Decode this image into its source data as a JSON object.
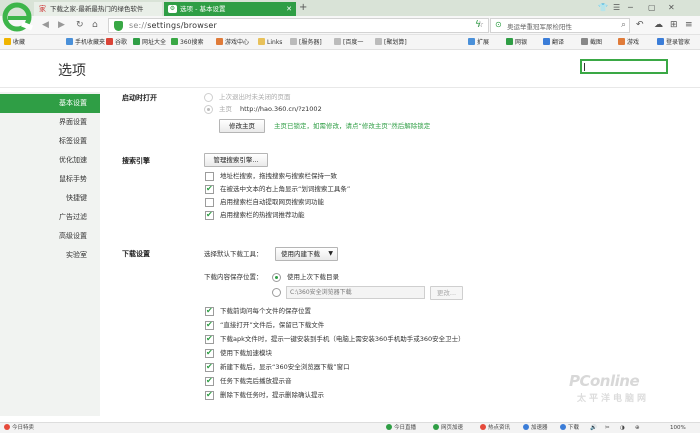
{
  "tabs": [
    {
      "label": "下载之家-最新最热门的绿色软件",
      "icon": "home-icon"
    },
    {
      "label": "选项 - 基本设置",
      "icon": "settings-page-icon",
      "active": true
    }
  ],
  "address_bar": {
    "scheme": "se://",
    "path": "settings/browser"
  },
  "search_bar": {
    "text": "奥运举重冠军尿检阳性"
  },
  "bookmarks": [
    "收藏",
    "手机收藏夹",
    "谷歌",
    "网址大全",
    "360搜索",
    "游戏中心",
    "Links",
    "[服务器]",
    "[百度一",
    "[聚划算]"
  ],
  "toolbar_right": [
    "扩展",
    "网银",
    "翻译",
    "截图",
    "游戏",
    "登录管家"
  ],
  "page": {
    "title": "选项"
  },
  "sidebar": {
    "items": [
      "基本设置",
      "界面设置",
      "标签设置",
      "优化加速",
      "鼠标手势",
      "快捷键",
      "广告过滤",
      "高级设置",
      "实验室"
    ]
  },
  "startup": {
    "title": "启动时打开",
    "option_last": "上次退出时未关闭的页面",
    "option_home": "主页",
    "home_url": "http://hao.360.cn/?z1002",
    "modify_button": "修改主页",
    "locked_note": "主页已锁定，如需修改，请点“修改主页”然后解除锁定"
  },
  "search_engine": {
    "title": "搜索引擎",
    "manage_button": "管理搜索引擎...",
    "options": [
      {
        "label": "地址栏搜索，拖拽搜索与搜索栏保持一致",
        "checked": false
      },
      {
        "label": "在被选中文本的右上角显示“划词搜索工具条”",
        "checked": true
      },
      {
        "label": "启用搜索栏自动提取网页搜索词功能",
        "checked": false
      },
      {
        "label": "启用搜索栏的热搜词推荐功能",
        "checked": true
      }
    ]
  },
  "download": {
    "title": "下载设置",
    "tool_label": "选择默认下载工具：",
    "tool_value": "使用内建下载",
    "location_label": "下载内容保存位置：",
    "option_last_dir": "使用上次下载目录",
    "path_value": "C:\\360安全浏览器下载",
    "change_button": "更改...",
    "options": [
      {
        "label": "下载前询问每个文件的保存位置",
        "checked": true
      },
      {
        "label": "“直接打开”文件后，保留已下载文件",
        "checked": true
      },
      {
        "label": "下载apk文件时，提示一键安装到手机（电脑上需安装360手机助手或360安全卫士）",
        "checked": true
      },
      {
        "label": "使用下载加速模块",
        "checked": true
      },
      {
        "label": "新建下载后，显示“360安全浏览器下载”窗口",
        "checked": true
      },
      {
        "label": "任务下载完后播放提示音",
        "checked": true
      },
      {
        "label": "删除下载任务时，提示删除确认提示",
        "checked": true
      }
    ]
  },
  "status_bar": {
    "left": "今日特卖",
    "items": [
      "今日直播",
      "网页加速",
      "热点资讯",
      "加速器",
      "下载"
    ],
    "zoom": "100%"
  },
  "watermark": {
    "line1": "PConline",
    "line2": "太平洋电脑网"
  },
  "colors": {
    "accent": "#2f9e45",
    "sidebar_bg": "#f1f3f1"
  }
}
